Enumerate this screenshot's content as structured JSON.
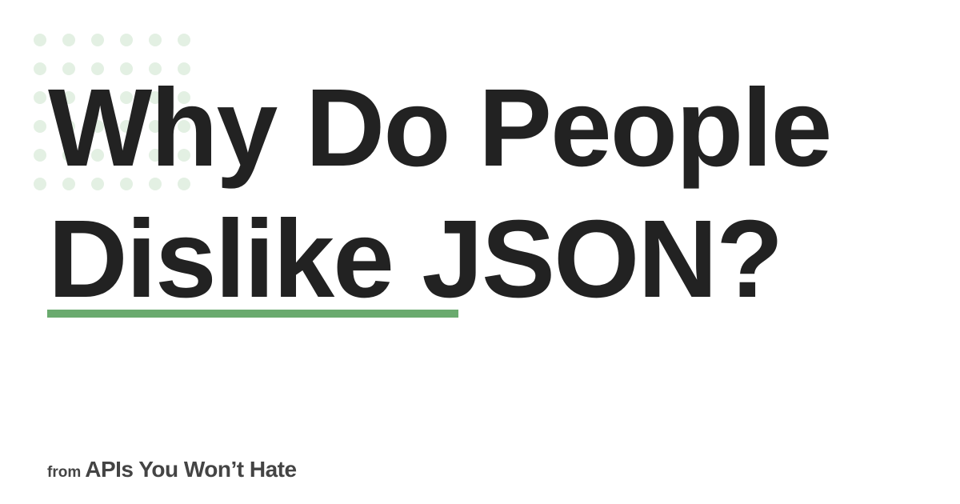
{
  "headline": {
    "line1": "Why Do People",
    "line2": "Dislike JSON?"
  },
  "footer": {
    "prefix": "from",
    "brand": "APIs You Won’t Hate"
  },
  "colors": {
    "accent": "#6aaa6e",
    "dots": "#e3f0e3",
    "text": "#222222",
    "footer_text": "#444444"
  }
}
